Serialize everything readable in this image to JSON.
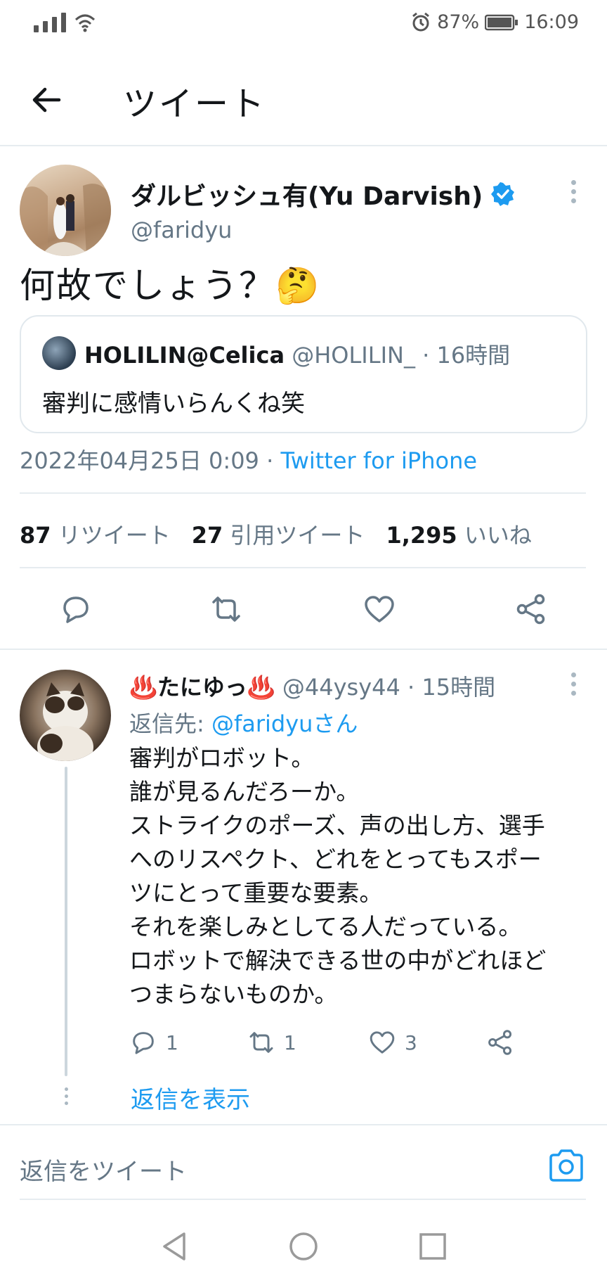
{
  "status_bar": {
    "battery": "87%",
    "time": "16:09"
  },
  "app_bar": {
    "title": "ツイート"
  },
  "tweet": {
    "author_name": "ダルビッシュ有(Yu Darvish)",
    "author_handle": "@faridyu",
    "text": "何故でしょう？🤔",
    "quote": {
      "author_name": "HOLILIN@Celica",
      "author_handle": "@HOLILIN_",
      "time": "· 16時間",
      "text": "審判に感情いらんくね笑"
    },
    "date": "2022年04月25日 0:09 · ",
    "source": "Twitter for iPhone",
    "stats": {
      "retweets_count": "87",
      "retweets_label": "リツイート",
      "quotes_count": "27",
      "quotes_label": "引用ツイート",
      "likes_count": "1,295",
      "likes_label": "いいね"
    }
  },
  "reply": {
    "author_name": "♨️たにゆっ♨️",
    "author_handle": "@44ysy44",
    "time": "· 15時間",
    "reply_to_prefix": "返信先: ",
    "reply_to_handle": "@faridyuさん",
    "lines": [
      "審判がロボット。",
      "誰が見るんだろーか。",
      "ストライクのポーズ、声の出し方、選手",
      "へのリスペクト、どれをとってもスポー",
      "ツにとって重要な要素。",
      "それを楽しみとしてる人だっている。",
      "ロボットで解決できる世の中がどれほど",
      "つまらないものか。"
    ],
    "reply_count": "1",
    "retweet_count": "1",
    "like_count": "3",
    "show_replies": "返信を表示"
  },
  "composer": {
    "placeholder": "返信をツイート"
  },
  "colors": {
    "accent": "#1d9bf0",
    "secondary": "#657786",
    "divider": "#e6ecf0"
  }
}
